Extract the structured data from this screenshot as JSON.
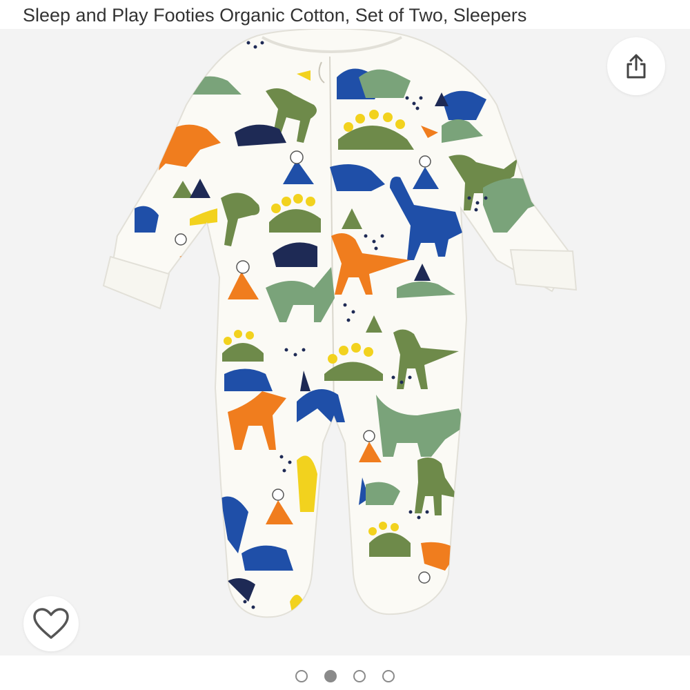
{
  "product": {
    "title": "Sleep and Play Footies Organic Cotton, Set of Two, Sleepers"
  },
  "gallery": {
    "image_subject": "white footed baby sleeper with colorful dinosaur print",
    "active_index": 1,
    "dots": [
      {
        "label": "image-1"
      },
      {
        "label": "image-2"
      },
      {
        "label": "image-3"
      },
      {
        "label": "image-4"
      }
    ]
  },
  "icons": {
    "share": "share-icon",
    "wishlist": "heart-icon"
  },
  "colors": {
    "background": "#f3f3f3",
    "garment": "#fbfaf5",
    "dino_green": "#6e8a4a",
    "dino_sage": "#7aa37a",
    "dino_blue": "#1f4fa8",
    "dino_navy": "#1e2a55",
    "dino_orange": "#f07d1e",
    "dino_yellow": "#f2d21e",
    "dot_indicator": "#8a8a8a"
  }
}
